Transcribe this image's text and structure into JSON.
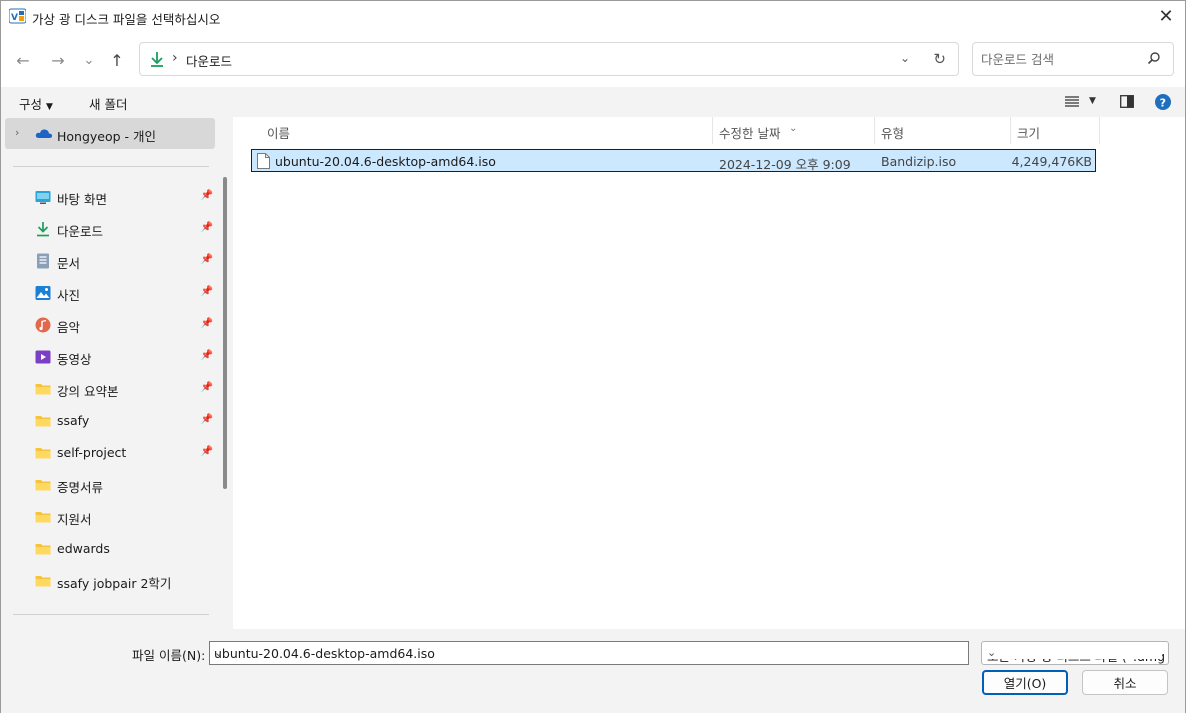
{
  "window": {
    "title": "가상 광 디스크 파일을 선택하십시오",
    "close_glyph": "✕"
  },
  "nav": {
    "back_glyph": "←",
    "forward_glyph": "→",
    "recent_glyph": "⌄",
    "up_glyph": "↑",
    "breadcrumb_sep": "›",
    "breadcrumb": "다운로드",
    "refresh_glyph": "↻",
    "search_placeholder": "다운로드 검색"
  },
  "commandbar": {
    "organize": "구성",
    "new_folder": "새 폴더"
  },
  "sidebar": {
    "onedrive": "Hongyeop - 개인",
    "items": [
      {
        "label": "바탕 화면",
        "icon": "desktop-icon",
        "pinned": true
      },
      {
        "label": "다운로드",
        "icon": "download-icon",
        "pinned": true
      },
      {
        "label": "문서",
        "icon": "documents-icon",
        "pinned": true
      },
      {
        "label": "사진",
        "icon": "pictures-icon",
        "pinned": true
      },
      {
        "label": "음악",
        "icon": "music-icon",
        "pinned": true
      },
      {
        "label": "동영상",
        "icon": "videos-icon",
        "pinned": true
      },
      {
        "label": "강의 요약본",
        "icon": "folder-icon",
        "pinned": true
      },
      {
        "label": "ssafy",
        "icon": "folder-icon",
        "pinned": true
      },
      {
        "label": "self-project",
        "icon": "folder-icon",
        "pinned": true
      },
      {
        "label": "증명서류",
        "icon": "folder-icon",
        "pinned": false
      },
      {
        "label": "지원서",
        "icon": "folder-icon",
        "pinned": false
      },
      {
        "label": "edwards",
        "icon": "folder-icon",
        "pinned": false
      },
      {
        "label": "ssafy jobpair 2학기",
        "icon": "folder-icon",
        "pinned": false
      }
    ]
  },
  "filelist": {
    "columns": [
      "이름",
      "수정한 날짜",
      "유형",
      "크기"
    ],
    "files": [
      {
        "name": "ubuntu-20.04.6-desktop-amd64.iso",
        "modified": "2024-12-09 오후 9:09",
        "type": "Bandizip.iso",
        "size": "4,249,476KB",
        "selected": true
      }
    ]
  },
  "footer": {
    "filename_label": "파일 이름(N):",
    "filename_value": "ubuntu-20.04.6-desktop-amd64.iso",
    "filter_value": "모든 가상 광 디스크 파일 (*.dmg",
    "open_button": "열기(O)",
    "cancel_button": "취소"
  },
  "colors": {
    "selection": "#cce8ff",
    "accent": "#005fb8",
    "download_green": "#1a9e5c",
    "folder_yellow": "#f5c43b"
  }
}
